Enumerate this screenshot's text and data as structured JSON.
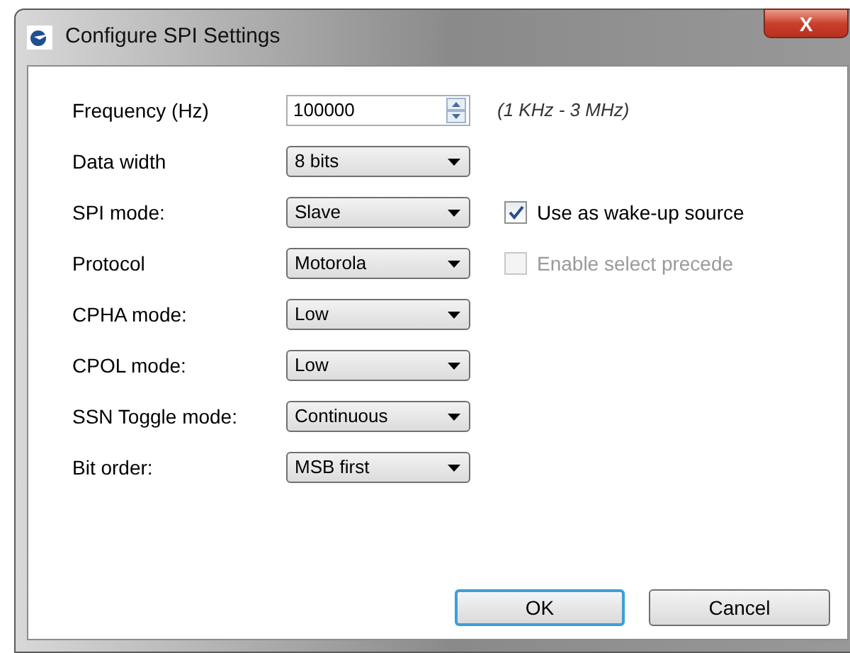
{
  "window": {
    "title": "Configure SPI Settings",
    "close_label": "X"
  },
  "fields": [
    {
      "kind": "spinner",
      "label": "Frequency (Hz)",
      "value": "100000",
      "hint": "(1 KHz - 3 MHz)"
    },
    {
      "kind": "dropdown",
      "label": "Data width",
      "value": "8 bits"
    },
    {
      "kind": "dropdown",
      "label": "SPI mode:",
      "value": "Slave",
      "checkbox": {
        "label": "Use as wake-up source",
        "checked": true,
        "disabled": false
      }
    },
    {
      "kind": "dropdown",
      "label": "Protocol",
      "value": "Motorola",
      "checkbox": {
        "label": "Enable select precede",
        "checked": false,
        "disabled": true
      }
    },
    {
      "kind": "dropdown",
      "label": "CPHA mode:",
      "value": "Low"
    },
    {
      "kind": "dropdown",
      "label": "CPOL mode:",
      "value": "Low"
    },
    {
      "kind": "dropdown",
      "label": "SSN Toggle mode:",
      "value": "Continuous"
    },
    {
      "kind": "dropdown",
      "label": "Bit order:",
      "value": "MSB first"
    }
  ],
  "buttons": [
    {
      "label": "OK",
      "default": true
    },
    {
      "label": "Cancel",
      "default": false
    }
  ]
}
